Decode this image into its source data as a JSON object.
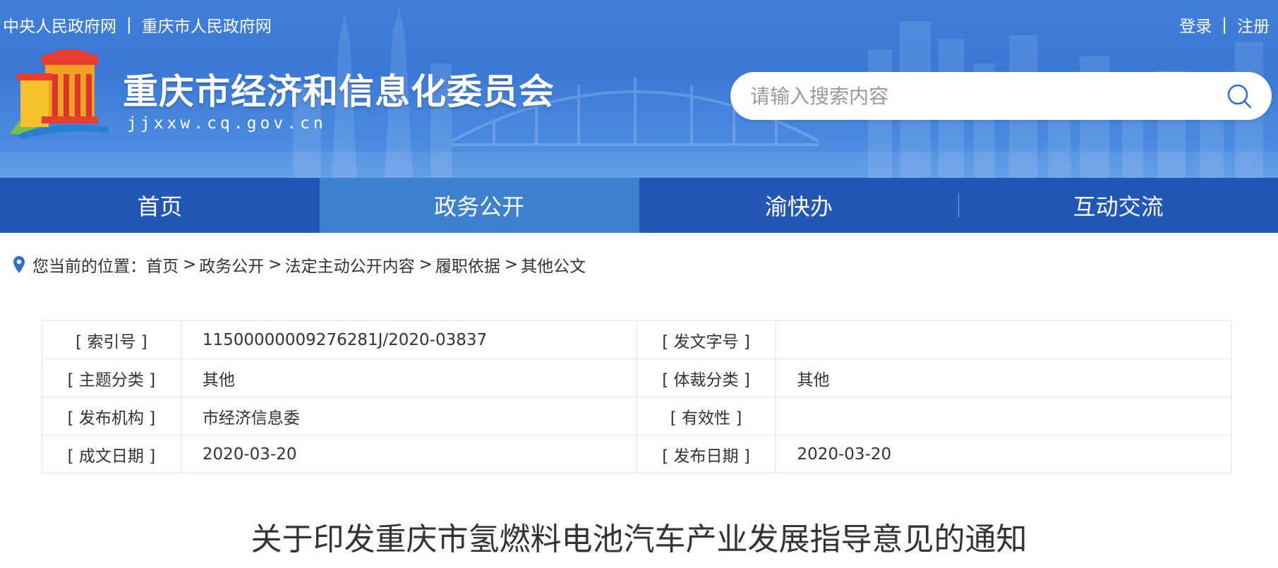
{
  "header": {
    "top_links": [
      "中央人民政府网",
      "重庆市人民政府网"
    ],
    "separator": "|",
    "account": {
      "login": "登录",
      "register": "注册"
    },
    "site_title": "重庆市经济和信息化委员会",
    "site_domain": "jjxxw.cq.gov.cn",
    "logo_icon": "government-building-logo",
    "search": {
      "placeholder": "请输入搜索内容",
      "icon": "search-icon"
    }
  },
  "nav": {
    "items": [
      {
        "label": "首页",
        "active": false
      },
      {
        "label": "政务公开",
        "active": true
      },
      {
        "label": "渝快办",
        "active": false
      },
      {
        "label": "互动交流",
        "active": false
      }
    ]
  },
  "breadcrumb": {
    "icon": "location-pin-icon",
    "prefix": "您当前的位置：",
    "items": [
      "首页",
      "政务公开",
      "法定主动公开内容",
      "履职依据",
      "其他公文"
    ],
    "arrow": ">"
  },
  "meta_table": {
    "rows": [
      {
        "l1": "[ 索引号 ]",
        "v1": "11500000009276281J/2020-03837",
        "l2": "[ 发文字号 ]",
        "v2": ""
      },
      {
        "l1": "[ 主题分类 ]",
        "v1": "其他",
        "l2": "[ 体裁分类 ]",
        "v2": "其他"
      },
      {
        "l1": "[ 发布机构 ]",
        "v1": "市经济信息委",
        "l2": "[ 有效性 ]",
        "v2": ""
      },
      {
        "l1": "[ 成文日期 ]",
        "v1": "2020-03-20",
        "l2": "[ 发布日期 ]",
        "v2": "2020-03-20"
      }
    ]
  },
  "document": {
    "title": "关于印发重庆市氢燃料电池汽车产业发展指导意见的通知"
  },
  "colors": {
    "header_blue": "#3b79d6",
    "nav_blue": "#2357b5",
    "nav_active": "#3d80cc",
    "pin_blue": "#2d6fd1"
  }
}
